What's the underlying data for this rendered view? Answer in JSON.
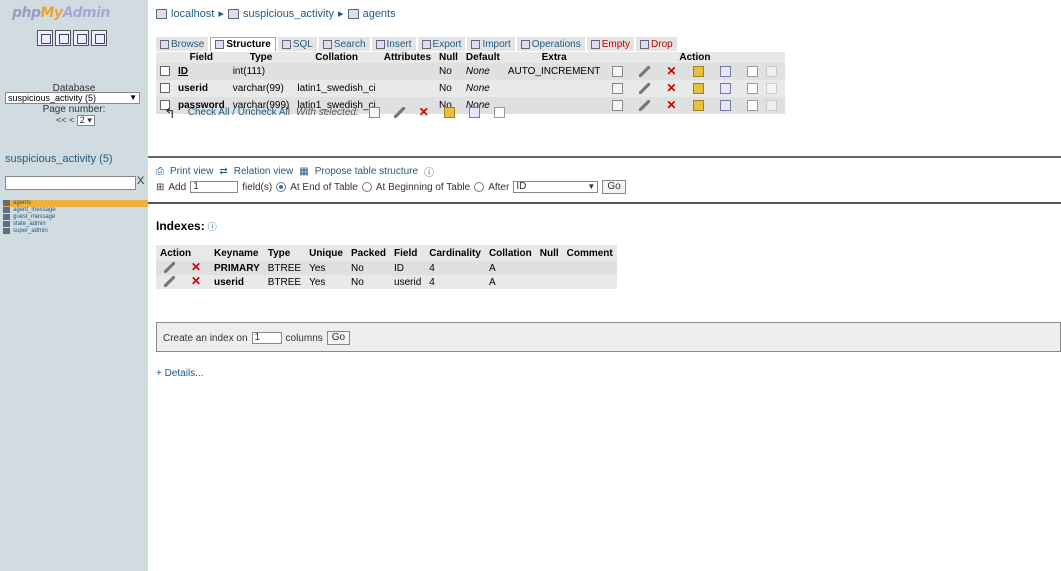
{
  "left": {
    "logo": {
      "php": "php",
      "my": "My",
      "admin": "Admin"
    },
    "quick_icons": [
      "home-icon",
      "logout-icon",
      "query-window-icon",
      "docs-icon"
    ],
    "database_label": "Database",
    "database_select": "suspicious_activity (5)",
    "page_number_label": "Page number:",
    "page_nav": "<< <",
    "page_value": "2",
    "db_title": "suspicious_activity (5)",
    "filter_clear": "X",
    "tables": [
      {
        "name": "agents",
        "active": true
      },
      {
        "name": "agent_message",
        "active": false
      },
      {
        "name": "guest_message",
        "active": false
      },
      {
        "name": "state_admin",
        "active": false
      },
      {
        "name": "super_admin",
        "active": false
      }
    ]
  },
  "breadcrumb": {
    "server": "localhost",
    "database": "suspicious_activity",
    "table": "agents",
    "sep": "▸"
  },
  "tabs": [
    {
      "label": "Browse",
      "active": false
    },
    {
      "label": "Structure",
      "active": true
    },
    {
      "label": "SQL",
      "active": false
    },
    {
      "label": "Search",
      "active": false
    },
    {
      "label": "Insert",
      "active": false
    },
    {
      "label": "Export",
      "active": false
    },
    {
      "label": "Import",
      "active": false
    },
    {
      "label": "Operations",
      "active": false
    },
    {
      "label": "Empty",
      "active": false,
      "danger": true
    },
    {
      "label": "Drop",
      "active": false,
      "danger": true
    }
  ],
  "structure": {
    "headers": [
      "",
      "Field",
      "Type",
      "Collation",
      "Attributes",
      "Null",
      "Default",
      "Extra",
      "Action"
    ],
    "rows": [
      {
        "field": "ID",
        "type": "int(111)",
        "collation": "",
        "attributes": "",
        "null": "No",
        "default": "None",
        "extra": "AUTO_INCREMENT",
        "primary": true
      },
      {
        "field": "userid",
        "type": "varchar(99)",
        "collation": "latin1_swedish_ci",
        "attributes": "",
        "null": "No",
        "default": "None",
        "extra": "",
        "primary": false
      },
      {
        "field": "password",
        "type": "varchar(999)",
        "collation": "latin1_swedish_ci",
        "attributes": "",
        "null": "No",
        "default": "None",
        "extra": "",
        "primary": false
      }
    ]
  },
  "check_row": {
    "check_all": "Check All / Uncheck All",
    "with_selected": "With selected:"
  },
  "print_row": {
    "print_view": "Print view",
    "relation_view": "Relation view",
    "propose": "Propose table structure"
  },
  "add_row": {
    "add": "Add",
    "count": "1",
    "fields": "field(s)",
    "end": "At End of Table",
    "beginning": "At Beginning of Table",
    "after": "After",
    "after_field": "ID",
    "go": "Go"
  },
  "indexes": {
    "title": "Indexes:",
    "headers": [
      "Action",
      "Keyname",
      "Type",
      "Unique",
      "Packed",
      "Field",
      "Cardinality",
      "Collation",
      "Null",
      "Comment"
    ],
    "rows": [
      {
        "keyname": "PRIMARY",
        "type": "BTREE",
        "unique": "Yes",
        "packed": "No",
        "field": "ID",
        "cardinality": "4",
        "collation": "A",
        "null": "",
        "comment": ""
      },
      {
        "keyname": "userid",
        "type": "BTREE",
        "unique": "Yes",
        "packed": "No",
        "field": "userid",
        "cardinality": "4",
        "collation": "A",
        "null": "",
        "comment": ""
      }
    ]
  },
  "create_index": {
    "label": "Create an index on",
    "value": "1",
    "columns": "columns",
    "go": "Go"
  },
  "details_link": "+ Details..."
}
